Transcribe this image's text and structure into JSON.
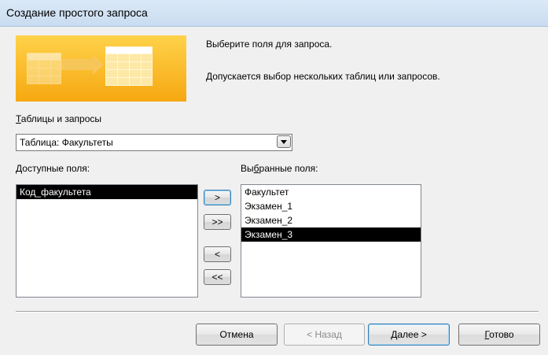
{
  "window": {
    "title": "Создание простого запроса"
  },
  "intro": {
    "line1": "Выберите поля для запроса.",
    "line2": "Допускается выбор нескольких таблиц или запросов."
  },
  "tables": {
    "label_accel": "Т",
    "label_rest": "аблицы и запросы",
    "selected": "Таблица: Факультеты"
  },
  "available": {
    "label_accel": "Д",
    "label_rest": "оступные поля:",
    "items": [
      {
        "text": "Код_факультета",
        "selected": true
      }
    ]
  },
  "selected_fields": {
    "label_pre": "Вы",
    "label_accel": "б",
    "label_rest": "ранные поля:",
    "items": [
      {
        "text": "Факультет",
        "selected": false
      },
      {
        "text": "Экзамен_1",
        "selected": false
      },
      {
        "text": "Экзамен_2",
        "selected": false
      },
      {
        "text": "Экзамен_3",
        "selected": true
      }
    ]
  },
  "move_buttons": {
    "add_one": ">",
    "add_all": ">>",
    "remove_one": "<",
    "remove_all": "<<"
  },
  "footer": {
    "cancel": "Отмена",
    "back": "< Назад",
    "next": "Далее >",
    "finish_accel": "Г",
    "finish_rest": "отово"
  },
  "colors": {
    "title_bar": "#c9dcf0",
    "selection": "#000000",
    "banner_orange": "#f6a811"
  },
  "icons": {
    "banner": "wizard-tables-graphic",
    "combo_arrow": "chevron-down-icon"
  }
}
